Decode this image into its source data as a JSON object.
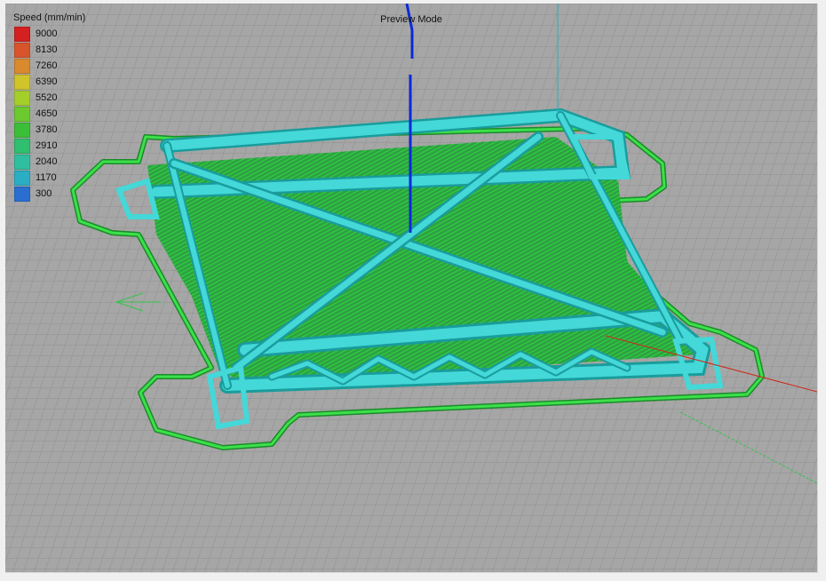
{
  "viewport": {
    "title": "Preview Mode"
  },
  "legend": {
    "title": "Speed (mm/min)",
    "items": [
      {
        "label": "9000",
        "color": "#d42020"
      },
      {
        "label": "8130",
        "color": "#d9542a"
      },
      {
        "label": "7260",
        "color": "#d98a2c"
      },
      {
        "label": "6390",
        "color": "#cfc42a"
      },
      {
        "label": "5520",
        "color": "#a4cf2a"
      },
      {
        "label": "4650",
        "color": "#6cc92e"
      },
      {
        "label": "3780",
        "color": "#3cbf38"
      },
      {
        "label": "2910",
        "color": "#2fbf6e"
      },
      {
        "label": "2040",
        "color": "#2fbfa0"
      },
      {
        "label": "1170",
        "color": "#2aaec4"
      },
      {
        "label": "300",
        "color": "#2a6fd0"
      }
    ]
  },
  "colors": {
    "background": "#a6a6a6",
    "grid": "#8f8f8f",
    "infill": "#22cc33",
    "skirt": "#1fb82e",
    "shell": "#44d8d8",
    "z_axis": "#0a2ad8",
    "x_axis": "#cc2a1a",
    "y_axis": "#2fc44a"
  },
  "icons": [
    "grid-floor",
    "axis-gizmo",
    "model-toolpath"
  ]
}
